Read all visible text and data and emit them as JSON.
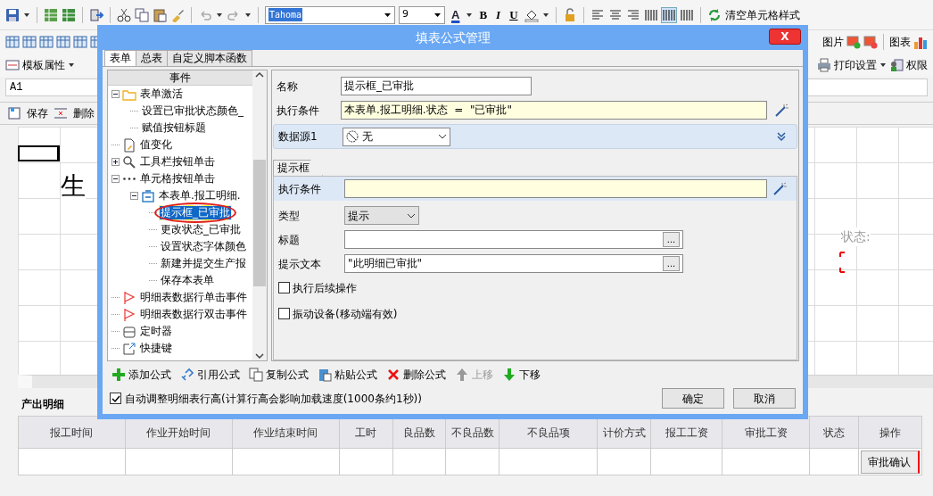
{
  "toolbar": {
    "font": "Tahoma",
    "font_size": "9",
    "font_color": "A",
    "format_buttons": [
      "B",
      "I",
      "U"
    ],
    "clear_style": "清空单元格样式",
    "image": "图片",
    "chart": "图表",
    "template_props": "模板属性",
    "print_settings": "打印设置",
    "permissions": "权限"
  },
  "cell_ref": "A1",
  "sheet_toolbar": [
    "保存",
    "删除"
  ],
  "sheet": {
    "title_fragment": "生",
    "status_label": "状态:"
  },
  "output_detail": {
    "title": "产出明细",
    "columns": [
      "报工时间",
      "作业开始时间",
      "作业结束时间",
      "工时",
      "良品数",
      "不良品数",
      "不良品项",
      "计价方式",
      "报工工资",
      "审批工资",
      "状态",
      "操作"
    ],
    "action_button": "审批确认"
  },
  "dialog": {
    "title": "填表公式管理",
    "close": "X",
    "tabs": [
      {
        "label": "表单",
        "selected": true
      },
      {
        "label": "总表",
        "selected": false
      },
      {
        "label": "自定义脚本函数",
        "selected": false
      }
    ],
    "tree": {
      "header": "事件",
      "items": [
        {
          "label": "表单激活",
          "kind": "folder",
          "expanded": true,
          "selected": false,
          "children": [
            {
              "label": "设置已审批状态颜色_",
              "selected": false
            },
            {
              "label": "赋值按钮标题",
              "selected": false
            }
          ]
        },
        {
          "label": "值变化",
          "kind": "document",
          "selected": false
        },
        {
          "label": "工具栏按钮单击",
          "kind": "search",
          "expanded": false,
          "selected": false
        },
        {
          "label": "单元格按钮单击",
          "kind": "dots",
          "expanded": true,
          "selected": false,
          "children": [
            {
              "label": "本表单.报工明细.",
              "kind": "form",
              "expanded": true,
              "selected": false,
              "children": [
                {
                  "label": "提示框_已审批",
                  "selected": true
                },
                {
                  "label": "更改状态_已审批",
                  "selected": false
                },
                {
                  "label": "设置状态字体颜色",
                  "selected": false
                },
                {
                  "label": "新建并提交生产报",
                  "selected": false
                },
                {
                  "label": "保存本表单",
                  "selected": false
                }
              ]
            }
          ]
        },
        {
          "label": "明细表数据行单击事件",
          "kind": "flag",
          "selected": false
        },
        {
          "label": "明细表数据行双击事件",
          "kind": "flag",
          "selected": false
        },
        {
          "label": "定时器",
          "kind": "timer",
          "selected": false
        },
        {
          "label": "快捷键",
          "kind": "shortcut",
          "selected": false
        }
      ]
    },
    "form": {
      "name_label": "名称",
      "name_value": "提示框_已审批",
      "condition_label": "执行条件",
      "condition_value": "本表单.报工明细.状态  =  \"已审批\"",
      "datasource_label": "数据源1",
      "datasource_value": "无",
      "section_tab": "提示框",
      "section_condition_label": "执行条件",
      "type_label": "类型",
      "type_value": "提示",
      "caption_label": "标题",
      "text_label": "提示文本",
      "text_value": "\"此明细已审批\"",
      "browse": [
        "...",
        "..."
      ],
      "options": [
        {
          "label": "执行后续操作",
          "checked": false
        },
        {
          "label": "振动设备(移动端有效)",
          "checked": false
        }
      ]
    },
    "actions": [
      {
        "label": "添加公式",
        "kind": "add",
        "disabled": false
      },
      {
        "label": "引用公式",
        "kind": "link",
        "disabled": false
      },
      {
        "label": "复制公式",
        "kind": "copy",
        "disabled": false
      },
      {
        "label": "粘贴公式",
        "kind": "paste",
        "disabled": false
      },
      {
        "label": "删除公式",
        "kind": "delete",
        "disabled": false
      },
      {
        "label": "上移",
        "kind": "up",
        "disabled": true
      },
      {
        "label": "下移",
        "kind": "down",
        "disabled": false
      }
    ],
    "auto_height": {
      "label": "自动调整明细表行高(计算行高会影响加载速度(1000条约1秒))",
      "checked": true
    },
    "buttons": [
      "确定",
      "取消"
    ]
  }
}
